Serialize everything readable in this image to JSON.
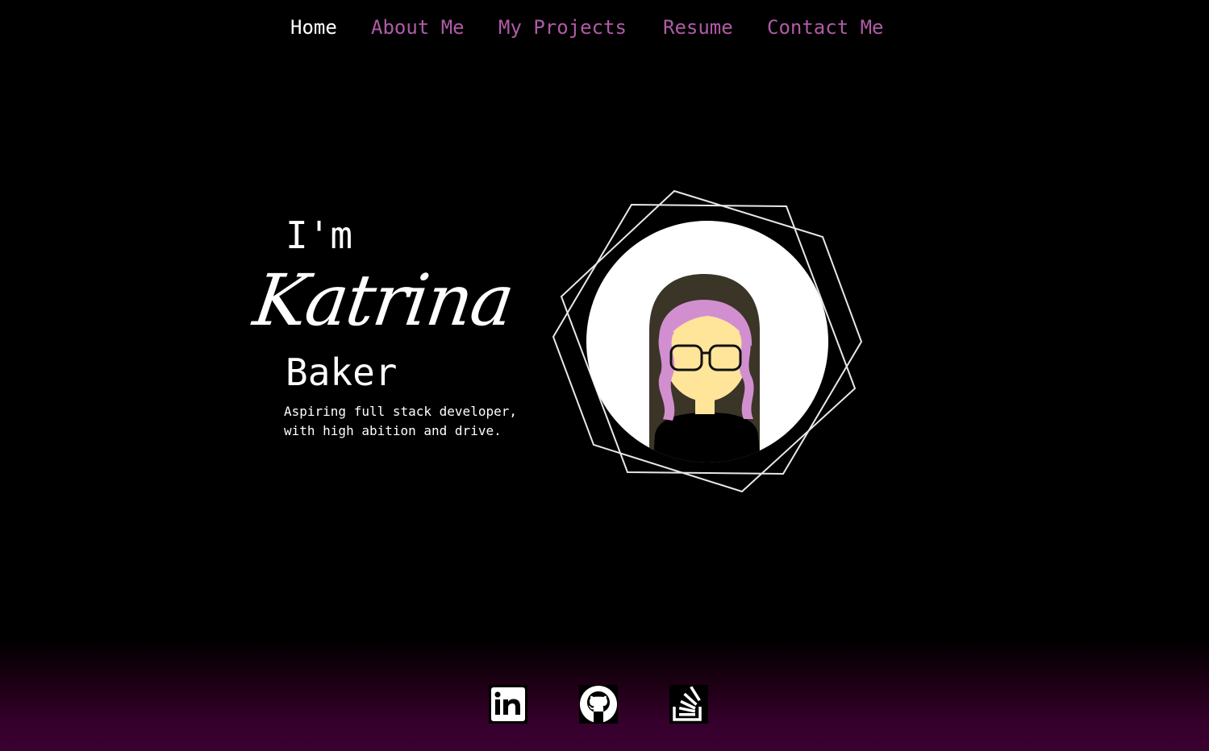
{
  "nav": {
    "items": [
      {
        "label": "Home",
        "active": true
      },
      {
        "label": "About Me",
        "active": false
      },
      {
        "label": "My Projects",
        "active": false
      },
      {
        "label": "Resume",
        "active": false
      },
      {
        "label": "Contact Me",
        "active": false
      }
    ]
  },
  "hero": {
    "intro": "I'm",
    "first_name": "Katrina",
    "last_name": "Baker",
    "tagline_line1": "Aspiring full stack developer,",
    "tagline_line2": "with high abition and drive."
  },
  "social": [
    {
      "icon": "linkedin-icon"
    },
    {
      "icon": "github-icon"
    },
    {
      "icon": "stackoverflow-icon"
    }
  ],
  "colors": {
    "background": "#000000",
    "nav_link": "#b05ba6",
    "nav_active": "#ffffff",
    "footer_gradient_end": "#3b0031",
    "avatar_hair": "#d28fd0",
    "avatar_skin": "#ffe59a",
    "avatar_dark_hair": "#3b3528"
  }
}
